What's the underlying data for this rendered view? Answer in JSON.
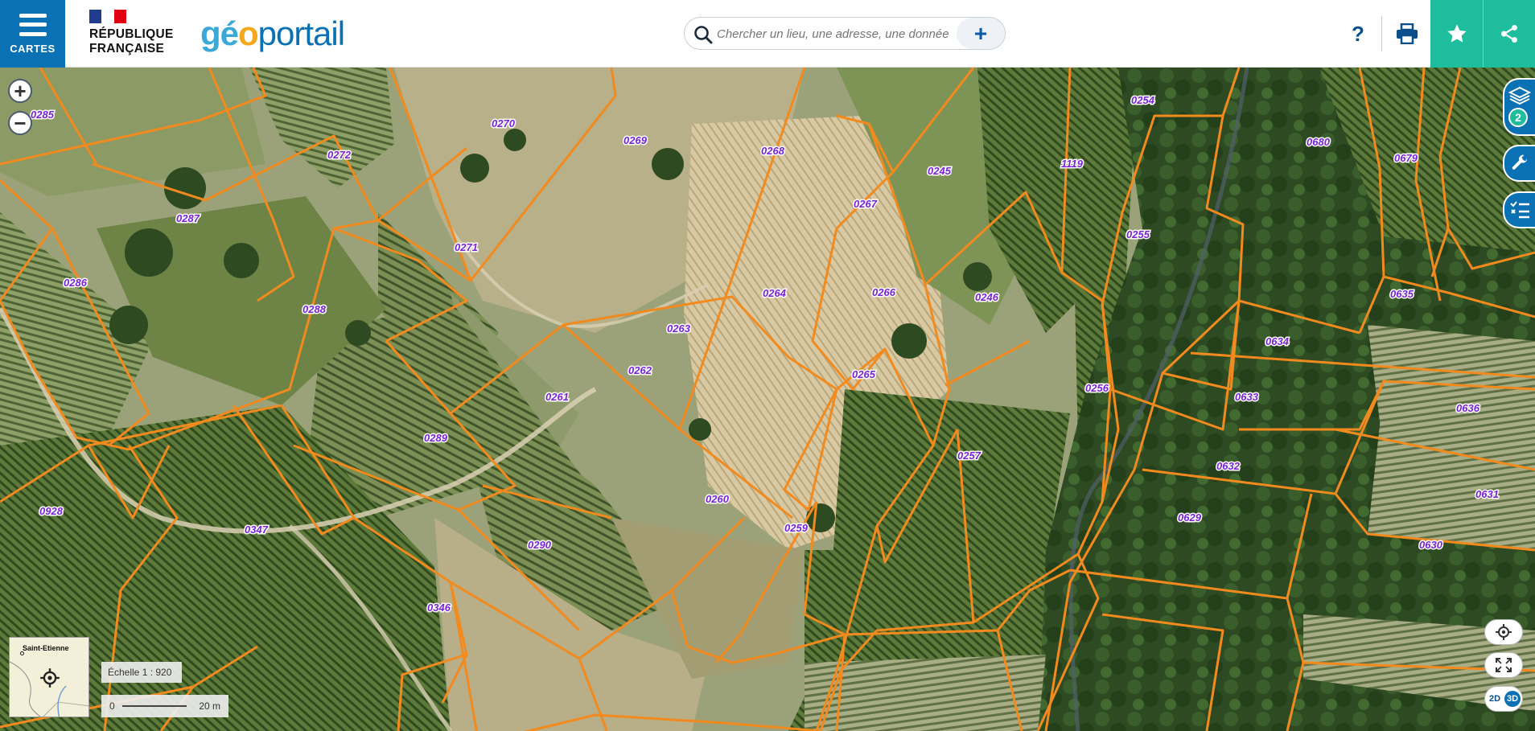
{
  "header": {
    "menu_label": "CARTES",
    "republique_line1": "RÉPUBLIQUE",
    "republique_line2": "FRANÇAISE",
    "logo_part1": "gé",
    "logo_part2": "o",
    "logo_part3": "portail",
    "search_placeholder": "Chercher un lieu, une adresse, une donnée",
    "add_label": "+",
    "help_label": "?",
    "icons": [
      "menu-icon",
      "search-icon",
      "help-icon",
      "print-icon",
      "star-icon",
      "share-icon"
    ]
  },
  "colors": {
    "brand_blue": "#0b71b5",
    "accent_green": "#1ebd9d",
    "parcel_outline": "#f28a1e",
    "parcel_label": "#7a22d6"
  },
  "map": {
    "parcels": [
      "0285",
      "0270",
      "0269",
      "0268",
      "0272",
      "0245",
      "0254",
      "0680",
      "0679",
      "1119",
      "0287",
      "0267",
      "0271",
      "0255",
      "0286",
      "0288",
      "0264",
      "0266",
      "0246",
      "0635",
      "0263",
      "0634",
      "0262",
      "0265",
      "0261",
      "0256",
      "0633",
      "0636",
      "0289",
      "0257",
      "0632",
      "0260",
      "0928",
      "0259",
      "0629",
      "0631",
      "0347",
      "0290",
      "0630",
      "0346"
    ],
    "layers_count": "2",
    "overview_city": "Saint-Etienne",
    "scale_label": "Échelle 1 : 920",
    "scale_zero": "0",
    "scale_distance": "20 m",
    "toggle_2d": "2D",
    "toggle_3d": "3D",
    "zoom_in": "+",
    "zoom_out": "−"
  }
}
